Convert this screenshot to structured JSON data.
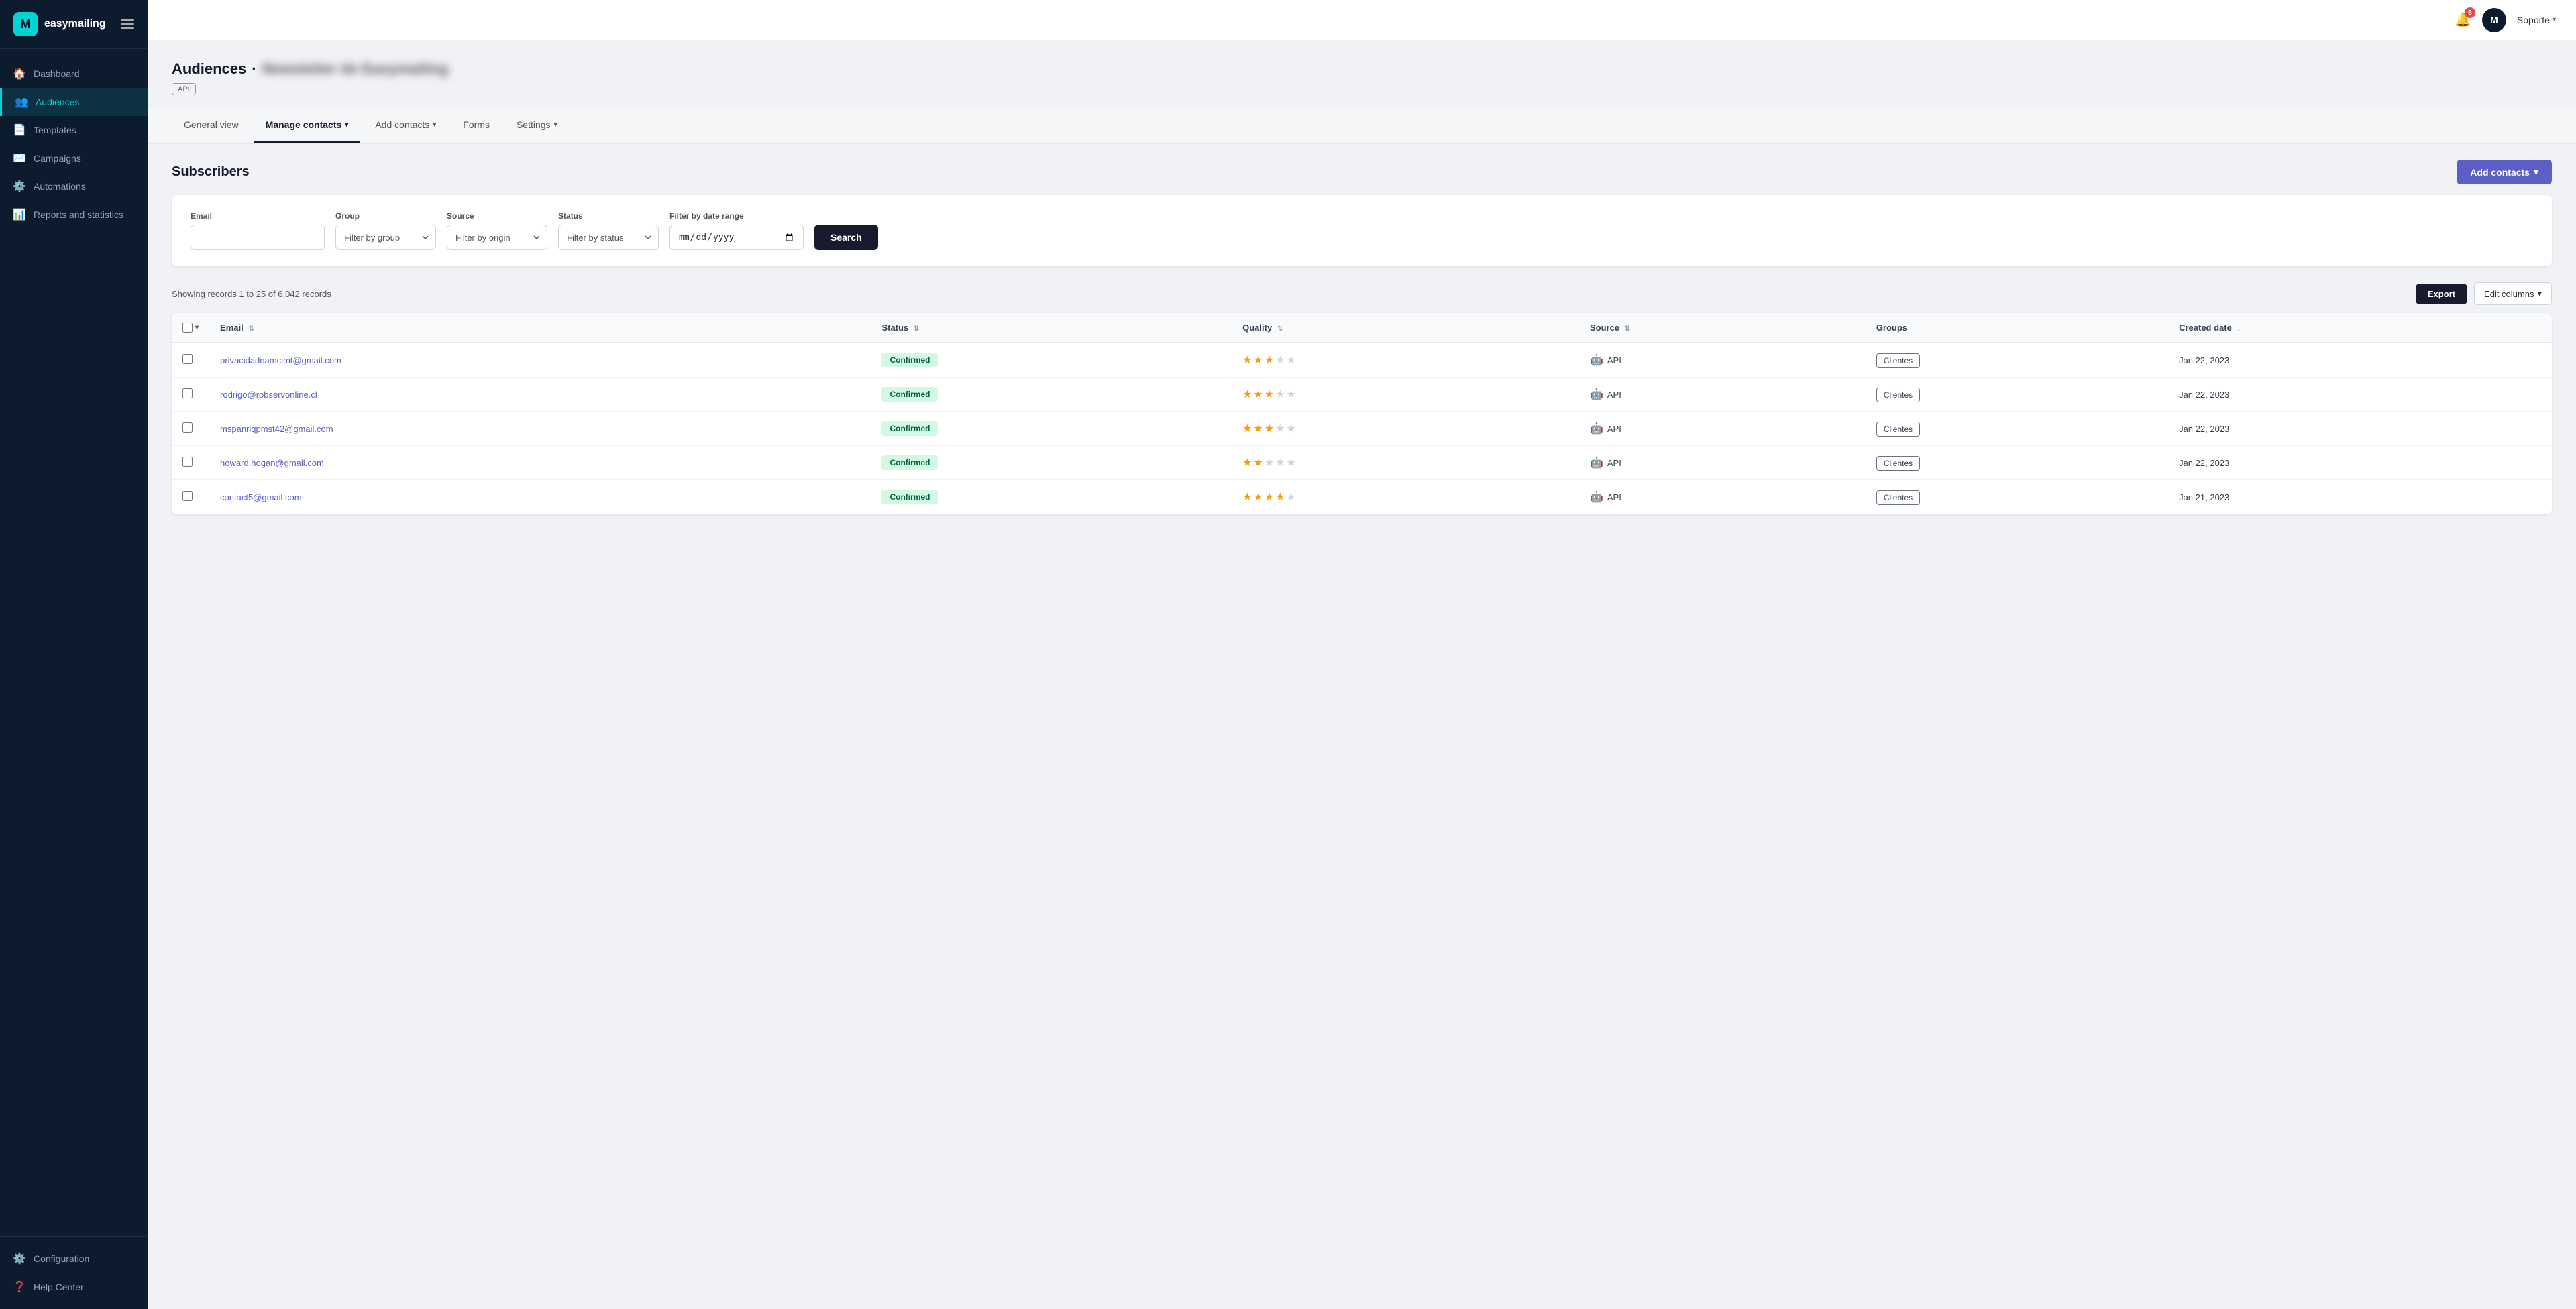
{
  "app": {
    "name": "easymailing",
    "logo_text": "M"
  },
  "topbar": {
    "notification_count": "5",
    "user_avatar": "M",
    "user_name": "Soporte"
  },
  "sidebar": {
    "items": [
      {
        "id": "dashboard",
        "label": "Dashboard",
        "icon": "🏠",
        "active": false
      },
      {
        "id": "audiences",
        "label": "Audiences",
        "icon": "👥",
        "active": true
      },
      {
        "id": "templates",
        "label": "Templates",
        "icon": "📄",
        "active": false
      },
      {
        "id": "campaigns",
        "label": "Campaigns",
        "icon": "✉️",
        "active": false
      },
      {
        "id": "automations",
        "label": "Automations",
        "icon": "⚙️",
        "active": false
      },
      {
        "id": "reports",
        "label": "Reports and statistics",
        "icon": "📊",
        "active": false
      }
    ],
    "bottom_items": [
      {
        "id": "configuration",
        "label": "Configuration",
        "icon": "⚙️"
      },
      {
        "id": "help",
        "label": "Help Center",
        "icon": "❓"
      }
    ]
  },
  "page": {
    "breadcrumb_label": "Audiences",
    "separator": "·",
    "audience_name": "Newsletter de Easymailing",
    "api_badge": "API"
  },
  "tabs": [
    {
      "id": "general_view",
      "label": "General view",
      "has_dropdown": false,
      "active": false
    },
    {
      "id": "manage_contacts",
      "label": "Manage contacts",
      "has_dropdown": true,
      "active": true
    },
    {
      "id": "add_contacts",
      "label": "Add contacts",
      "has_dropdown": true,
      "active": false
    },
    {
      "id": "forms",
      "label": "Forms",
      "has_dropdown": false,
      "active": false
    },
    {
      "id": "settings",
      "label": "Settings",
      "has_dropdown": true,
      "active": false
    }
  ],
  "subscribers": {
    "section_title": "Subscribers",
    "add_button": "Add contacts",
    "add_button_chevron": "▾"
  },
  "filters": {
    "email_label": "Email",
    "email_placeholder": "",
    "group_label": "Group",
    "group_placeholder": "Filter by group",
    "source_label": "Source",
    "source_placeholder": "Filter by origin",
    "status_label": "Status",
    "status_placeholder": "Filter by status",
    "date_range_label": "Filter by date range",
    "search_button": "Search"
  },
  "table": {
    "records_info": "Showing records 1 to 25 of 6,042 records",
    "export_button": "Export",
    "edit_columns_button": "Edit columns",
    "columns": [
      {
        "id": "email",
        "label": "Email",
        "sortable": true
      },
      {
        "id": "status",
        "label": "Status",
        "sortable": true
      },
      {
        "id": "quality",
        "label": "Quality",
        "sortable": true
      },
      {
        "id": "source",
        "label": "Source",
        "sortable": true
      },
      {
        "id": "groups",
        "label": "Groups",
        "sortable": false
      },
      {
        "id": "created_date",
        "label": "Created date",
        "sortable": true
      }
    ],
    "rows": [
      {
        "email": "privacidadnamcimt@gmail.com",
        "status": "Confirmed",
        "quality_stars": 3,
        "source": "API",
        "groups": "Clientes",
        "created_date": "Jan 22, 2023"
      },
      {
        "email": "rodrigo@robservonline.cl",
        "status": "Confirmed",
        "quality_stars": 3,
        "source": "API",
        "groups": "Clientes",
        "created_date": "Jan 22, 2023"
      },
      {
        "email": "mspanriqpmst42@gmail.com",
        "status": "Confirmed",
        "quality_stars": 3,
        "source": "API",
        "groups": "Clientes",
        "created_date": "Jan 22, 2023"
      },
      {
        "email": "howard.hogan@gmail.com",
        "status": "Confirmed",
        "quality_stars": 2,
        "source": "API",
        "groups": "Clientes",
        "created_date": "Jan 22, 2023"
      },
      {
        "email": "contact5@gmail.com",
        "status": "Confirmed",
        "quality_stars": 4,
        "source": "API",
        "groups": "Clientes",
        "created_date": "Jan 21, 2023"
      }
    ]
  }
}
